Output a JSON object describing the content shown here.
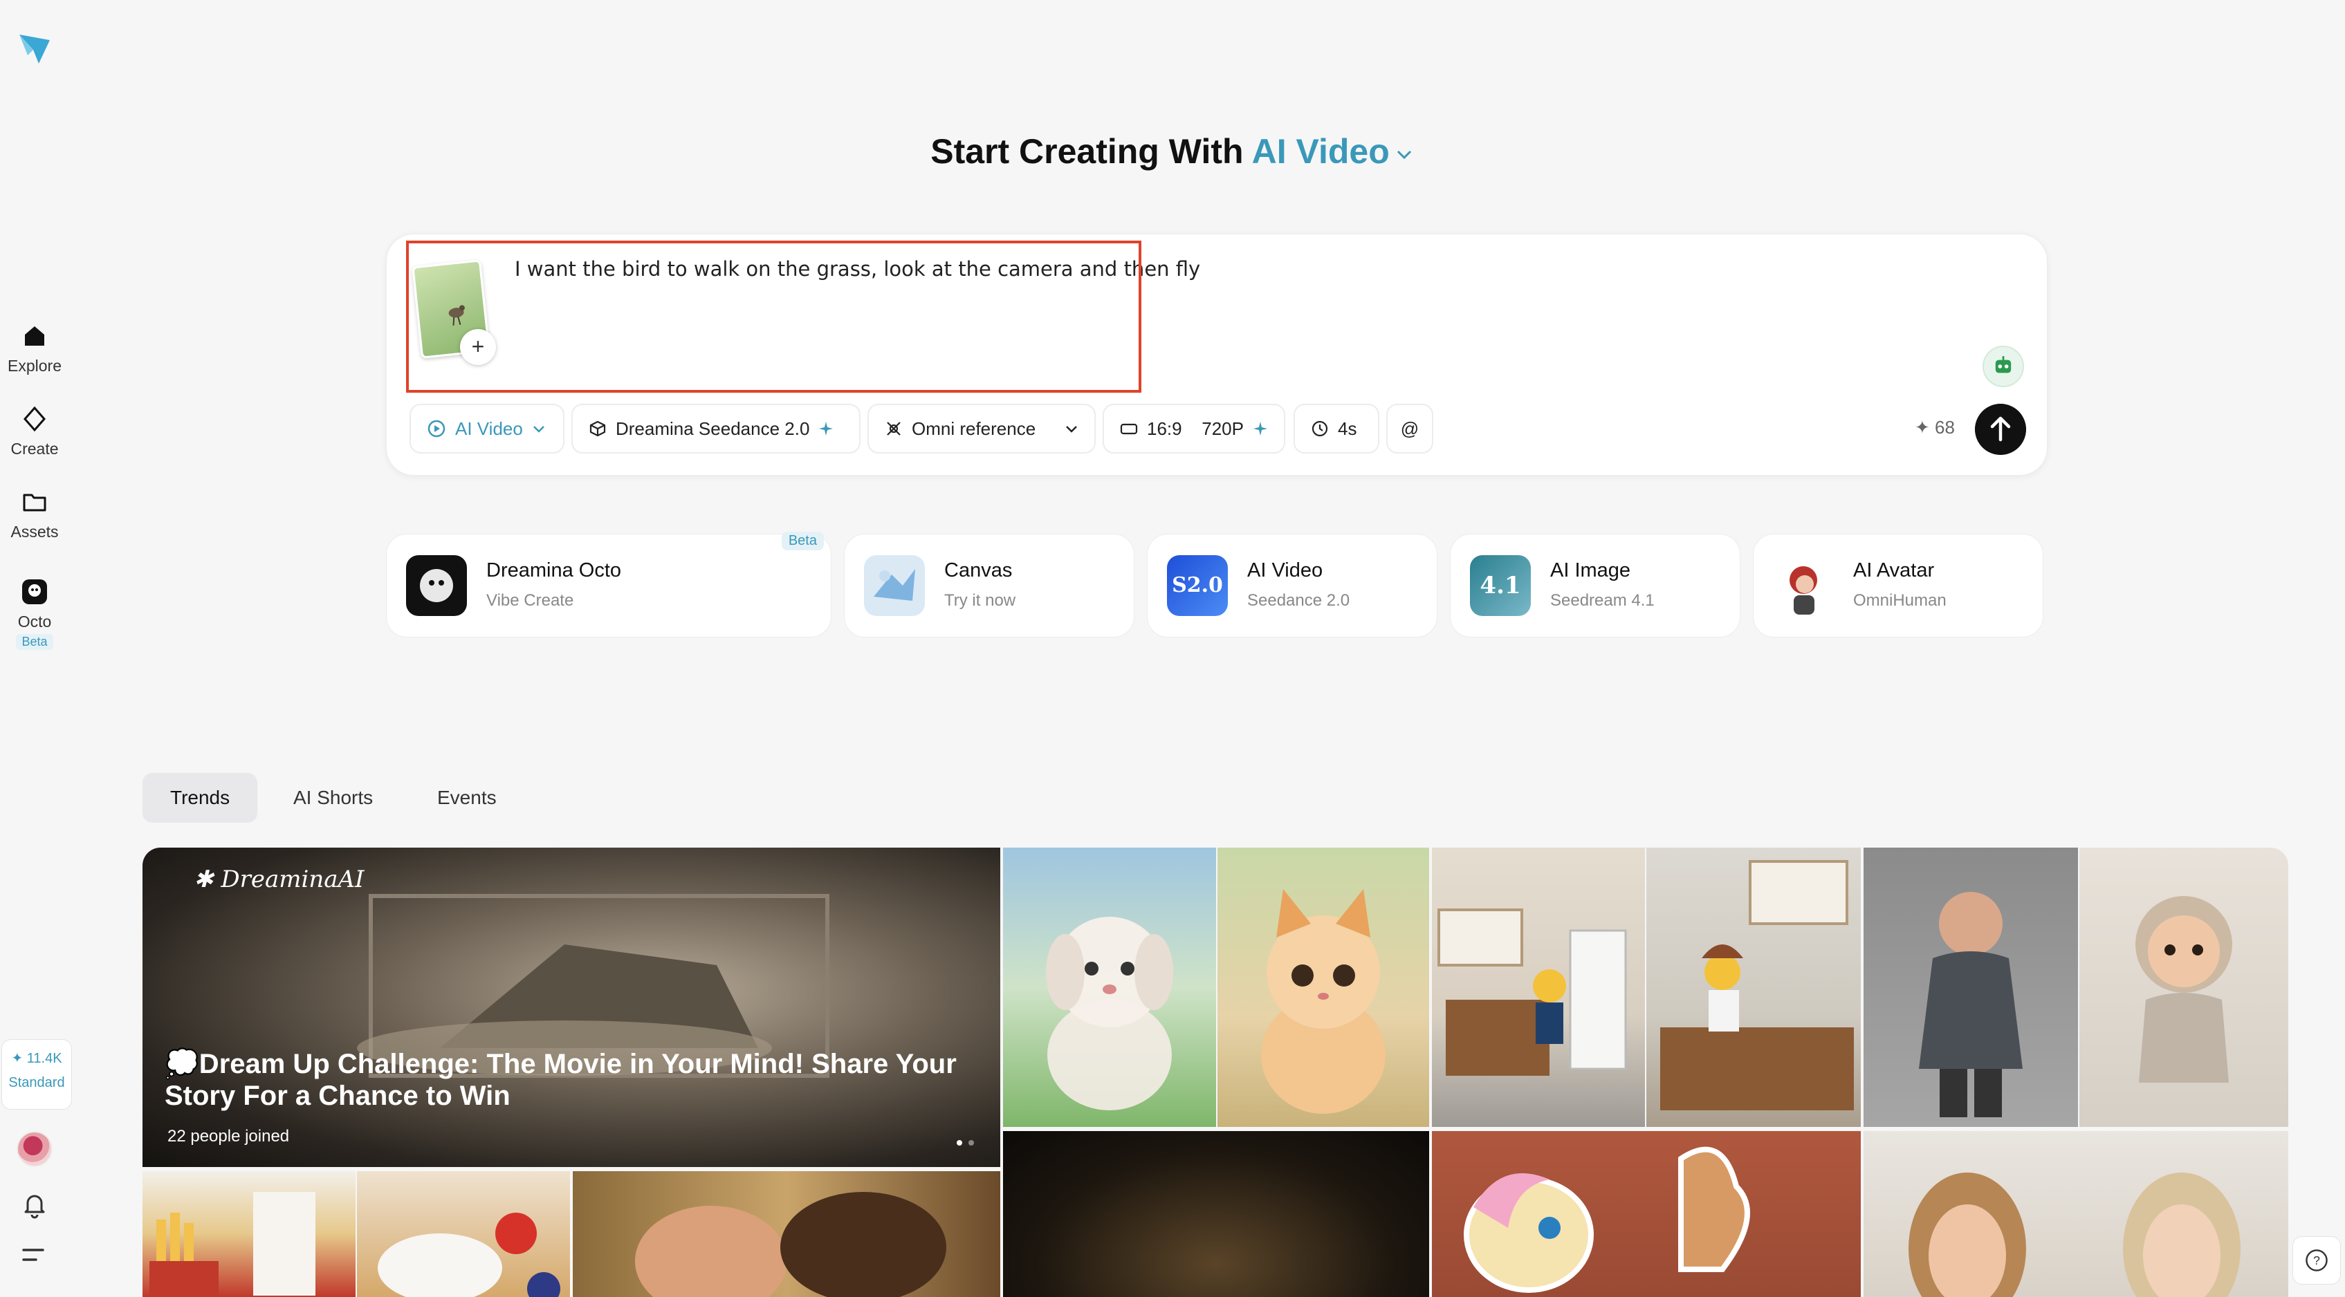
{
  "sidebar": {
    "nav": [
      {
        "label": "Explore"
      },
      {
        "label": "Create"
      },
      {
        "label": "Assets"
      },
      {
        "label": "Octo",
        "badge": "Beta"
      }
    ],
    "credits": {
      "value": "11.4K",
      "plan": "Standard"
    }
  },
  "headline": {
    "prefix": "Start Creating With",
    "mode": "AI Video"
  },
  "prompt": {
    "text": "I want the bird to walk on the grass, look at the camera and then fly",
    "attachment_icon": "bird-on-grass-thumbnail"
  },
  "toolbar": {
    "mode": "AI Video",
    "model": "Dreamina Seedance 2.0",
    "reference": "Omni reference",
    "ratio": "16:9",
    "resolution": "720P",
    "duration": "4s",
    "mention": "@",
    "cost": "68"
  },
  "tools": [
    {
      "title": "Dreamina Octo",
      "subtitle": "Vibe Create",
      "badge": "Beta"
    },
    {
      "title": "Canvas",
      "subtitle": "Try it now"
    },
    {
      "title": "AI Video",
      "subtitle": "Seedance 2.0",
      "icon_text": "S2.0"
    },
    {
      "title": "AI Image",
      "subtitle": "Seedream 4.1",
      "icon_text": "4.1"
    },
    {
      "title": "AI Avatar",
      "subtitle": "OmniHuman"
    }
  ],
  "tabs": [
    {
      "label": "Trends"
    },
    {
      "label": "AI Shorts"
    },
    {
      "label": "Events"
    }
  ],
  "hero": {
    "brand": "DreaminaAI",
    "title": "💭Dream Up Challenge: The Movie in Your Mind! Share Your Story For a Chance to Win",
    "joined": "22  people joined"
  },
  "colors": {
    "accent": "#3a98b9",
    "highlight_border": "#e0422b"
  }
}
